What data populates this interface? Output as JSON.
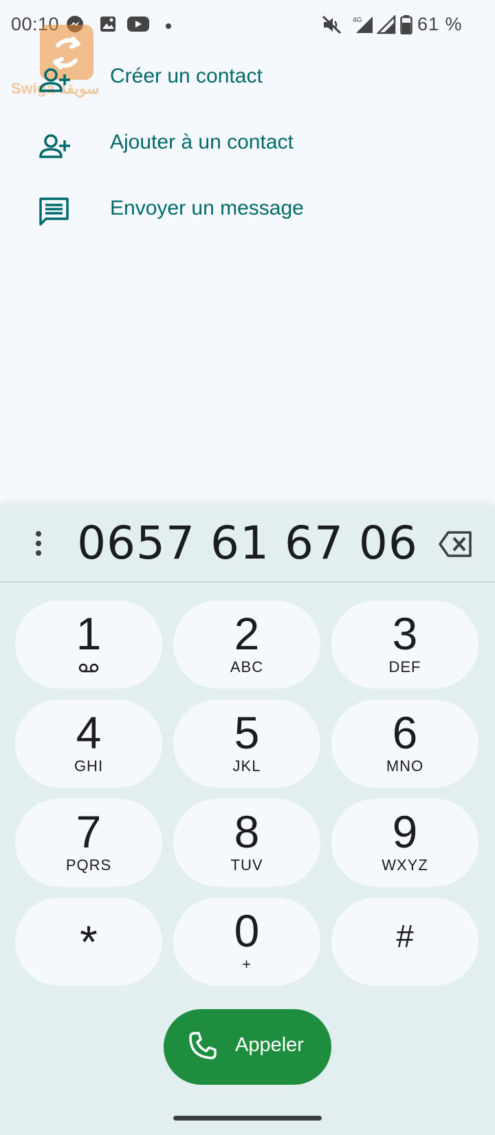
{
  "status_bar": {
    "time": "00:10",
    "battery_percent": "61 %",
    "network_type": "4G",
    "left_icons": [
      "messenger-icon",
      "image-gallery-icon",
      "youtube-icon",
      "dot-icon"
    ],
    "right_icons": [
      "mute-icon",
      "signal-4g-icon",
      "signal-icon",
      "battery-icon"
    ]
  },
  "watermark": {
    "text": "Swiga سويقة"
  },
  "actions": [
    {
      "label": "Créer un contact",
      "icon": "person-add-icon"
    },
    {
      "label": "Ajouter à un contact",
      "icon": "person-add-icon"
    },
    {
      "label": "Envoyer un message",
      "icon": "message-icon"
    }
  ],
  "dialer": {
    "number": "0657 61 67 06",
    "keys": [
      {
        "digit": "1",
        "letters": "",
        "sub_icon": "voicemail-icon"
      },
      {
        "digit": "2",
        "letters": "ABC"
      },
      {
        "digit": "3",
        "letters": "DEF"
      },
      {
        "digit": "4",
        "letters": "GHI"
      },
      {
        "digit": "5",
        "letters": "JKL"
      },
      {
        "digit": "6",
        "letters": "MNO"
      },
      {
        "digit": "7",
        "letters": "PQRS"
      },
      {
        "digit": "8",
        "letters": "TUV"
      },
      {
        "digit": "9",
        "letters": "WXYZ"
      },
      {
        "digit": "*",
        "letters": ""
      },
      {
        "digit": "0",
        "letters": "+"
      },
      {
        "digit": "#",
        "letters": ""
      }
    ],
    "call_label": "Appeler"
  },
  "colors": {
    "accent_teal": "#006a6a",
    "call_green": "#1e8e3e",
    "panel_bg": "#e2eeef",
    "page_bg": "#f5f9fd"
  }
}
